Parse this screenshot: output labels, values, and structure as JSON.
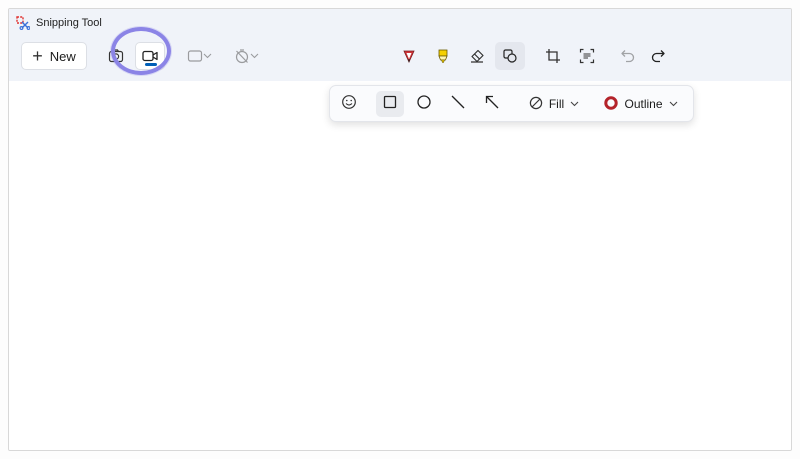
{
  "window": {
    "title": "Snipping Tool"
  },
  "toolbar": {
    "new_label": "New",
    "accent_color": "#005fb8",
    "highlight_ring_color": "#8b84e6",
    "modes": [
      {
        "icon": "camera-icon",
        "selected": false
      },
      {
        "icon": "video-camera-icon",
        "selected": true
      }
    ],
    "snip_shape_icon": "rectangle-snip-icon",
    "delay_icon": "no-delay-timer-icon",
    "tools": [
      {
        "icon": "ballpoint-pen-icon",
        "color": "#d13438"
      },
      {
        "icon": "highlighter-icon",
        "color": "#f5d000"
      },
      {
        "icon": "eraser-icon"
      },
      {
        "icon": "shapes-icon",
        "selected": true
      },
      {
        "icon": "crop-icon"
      },
      {
        "icon": "text-actions-icon"
      },
      {
        "icon": "undo-icon",
        "enabled": false
      },
      {
        "icon": "redo-icon",
        "enabled": true
      }
    ]
  },
  "shape_panel": {
    "fill_label": "Fill",
    "outline_label": "Outline",
    "outline_color": "#b4232a",
    "shapes": [
      {
        "icon": "emoji-icon"
      },
      {
        "icon": "rectangle-icon",
        "selected": true
      },
      {
        "icon": "ellipse-icon"
      },
      {
        "icon": "line-icon"
      },
      {
        "icon": "arrow-icon"
      }
    ]
  }
}
